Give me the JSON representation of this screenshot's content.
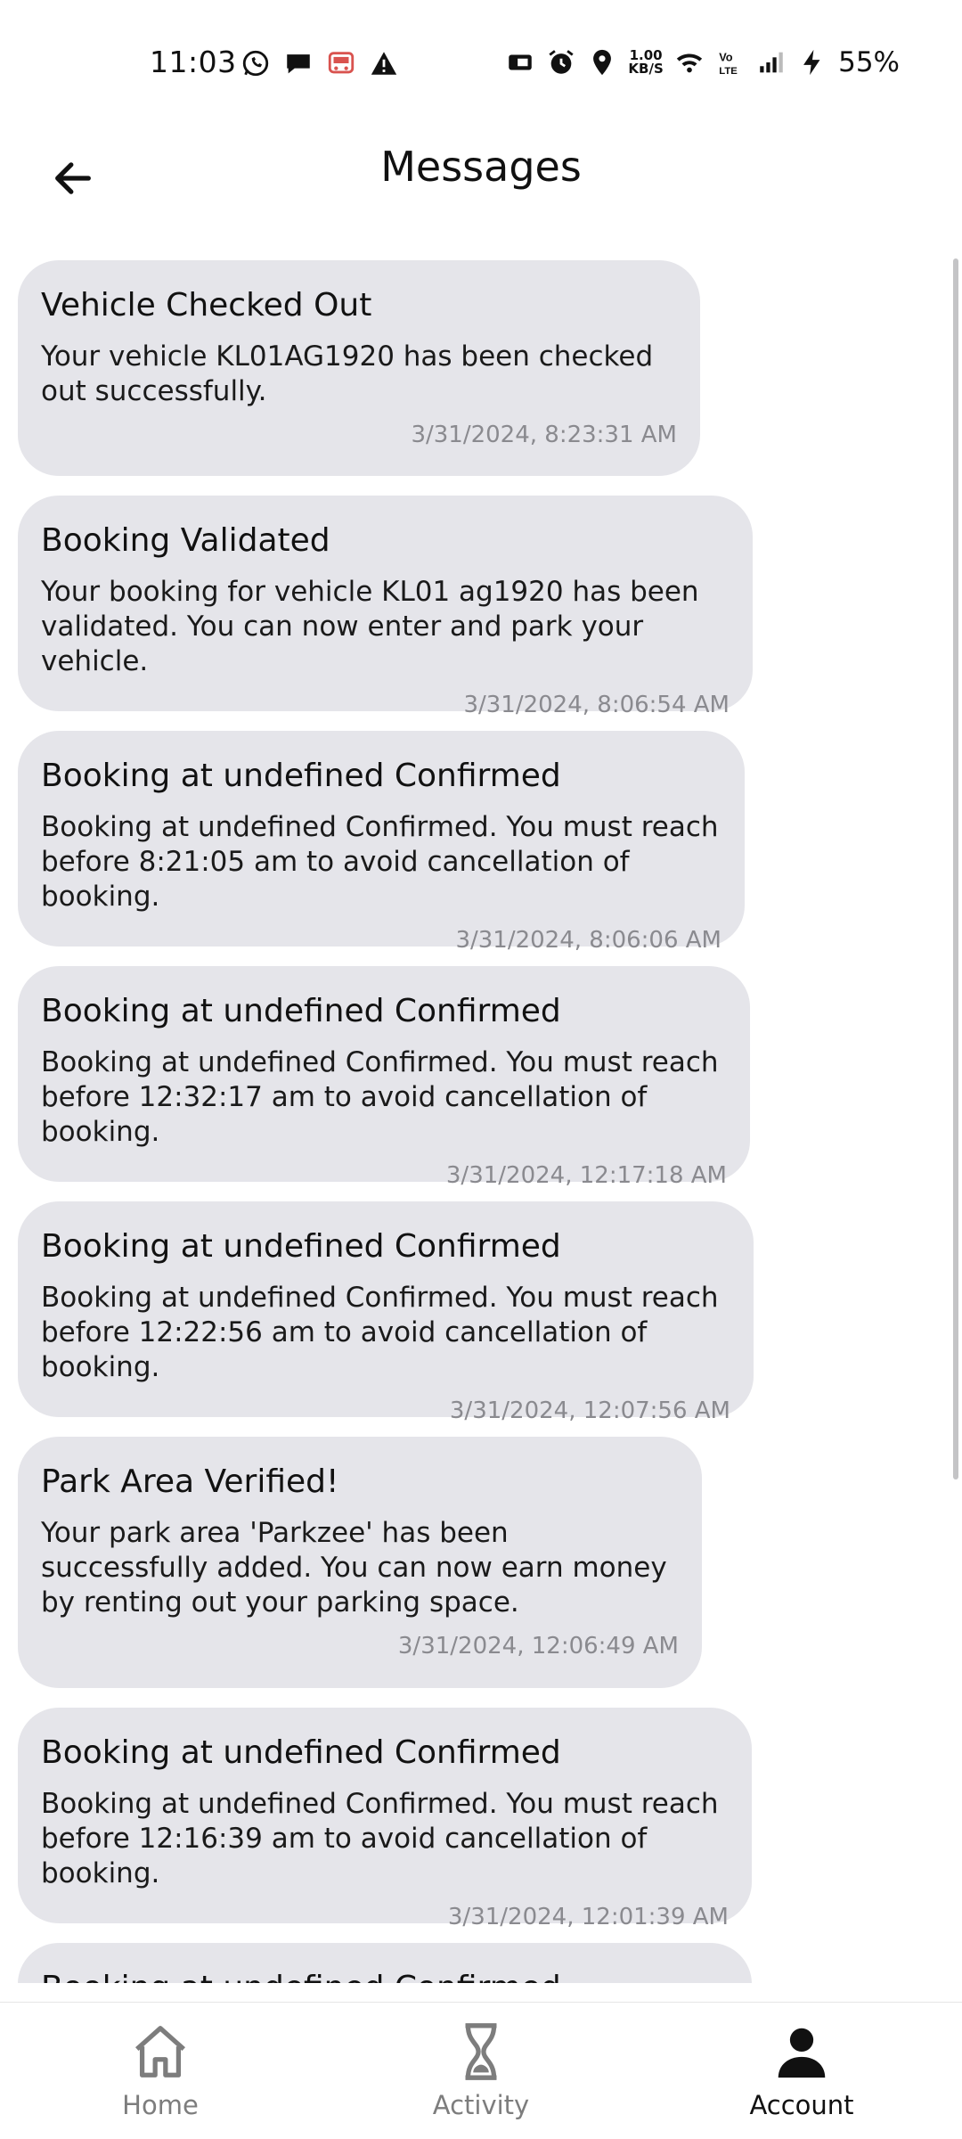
{
  "status_bar": {
    "time": "11:03",
    "net_speed_value": "1.00",
    "net_speed_unit": "KB/S",
    "battery_percent": "55%",
    "left_icons": [
      "whatsapp-icon",
      "chat-icon",
      "irctc-icon",
      "alert-icon"
    ],
    "right_icons": [
      "cast-icon",
      "alarm-icon",
      "location-icon",
      "wifi-icon",
      "volte-icon",
      "signal-icon",
      "charging-icon"
    ]
  },
  "header": {
    "title": "Messages",
    "back_icon": "arrow-left-icon"
  },
  "messages": [
    {
      "title": "Vehicle Checked Out",
      "body": "Your vehicle KL01AG1920 has been checked out successfully.",
      "timestamp": "3/31/2024, 8:23:31 AM"
    },
    {
      "title": "Booking Validated",
      "body": "Your booking for vehicle KL01 ag1920 has been validated. You can now enter and park your vehicle.",
      "timestamp": "3/31/2024, 8:06:54 AM"
    },
    {
      "title": "Booking at undefined Confirmed",
      "body": "Booking at undefined Confirmed. You must reach before 8:21:05 am to avoid cancellation of booking.",
      "timestamp": "3/31/2024, 8:06:06 AM"
    },
    {
      "title": "Booking at undefined Confirmed",
      "body": "Booking at undefined Confirmed. You must reach before 12:32:17 am to avoid cancellation of booking.",
      "timestamp": "3/31/2024, 12:17:18 AM"
    },
    {
      "title": "Booking at undefined Confirmed",
      "body": "Booking at undefined Confirmed. You must reach before 12:22:56 am to avoid cancellation of booking.",
      "timestamp": "3/31/2024, 12:07:56 AM"
    },
    {
      "title": "Park Area Verified!",
      "body": "Your park area 'Parkzee' has been successfully added. You can now earn money by renting out your parking space.",
      "timestamp": "3/31/2024, 12:06:49 AM"
    },
    {
      "title": "Booking at undefined Confirmed",
      "body": "Booking at undefined Confirmed. You must reach before 12:16:39 am to avoid cancellation of booking.",
      "timestamp": "3/31/2024, 12:01:39 AM"
    },
    {
      "title": "Booking at undefined Confirmed",
      "body": "",
      "timestamp": ""
    }
  ],
  "bottom_nav": {
    "items": [
      {
        "label": "Home",
        "icon": "home-icon",
        "active": false
      },
      {
        "label": "Activity",
        "icon": "hourglass-icon",
        "active": false
      },
      {
        "label": "Account",
        "icon": "person-icon",
        "active": true
      }
    ]
  }
}
